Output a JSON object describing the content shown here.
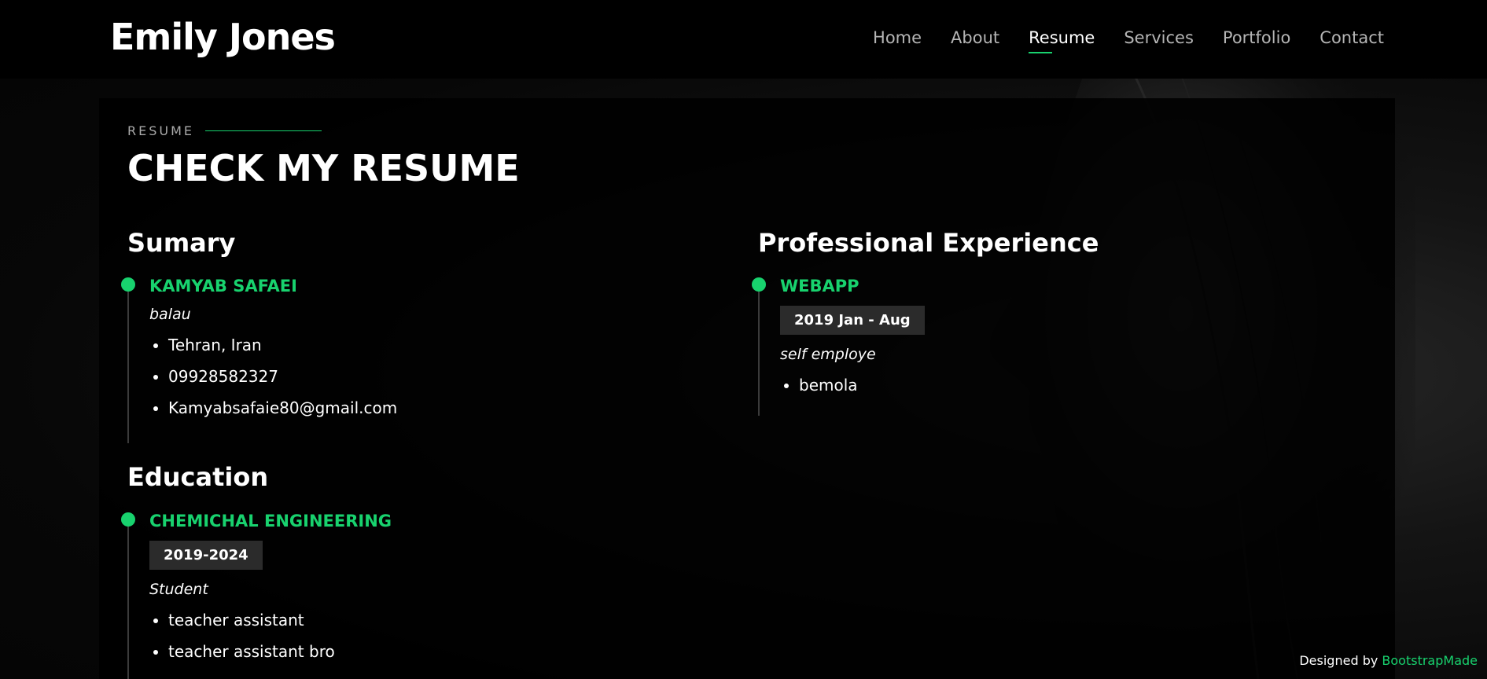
{
  "header": {
    "logo": "Emily Jones",
    "nav": [
      "Home",
      "About",
      "Resume",
      "Services",
      "Portfolio",
      "Contact"
    ],
    "active_nav": "Resume"
  },
  "resume": {
    "label": "RESUME",
    "title": "CHECK MY RESUME",
    "summary": {
      "heading": "Sumary",
      "name": "KAMYAB SAFAEI",
      "subtitle": "balau",
      "details": [
        "Tehran, Iran",
        "09928582327",
        "Kamyabsafaie80@gmail.com"
      ]
    },
    "education": {
      "heading": "Education",
      "title": "CHEMICHAL ENGINEERING",
      "period": "2019-2024",
      "subtitle": "Student",
      "details": [
        "teacher assistant",
        "teacher assistant bro"
      ]
    },
    "experience": {
      "heading": "Professional Experience",
      "title": "WEBAPP",
      "period": "2019 Jan - Aug",
      "subtitle": "self employe",
      "details": [
        "bemola"
      ]
    }
  },
  "credit": {
    "prefix": "Designed by",
    "link": "BootstrapMade"
  },
  "colors": {
    "accent": "#18d26e",
    "background": "#050505",
    "badge": "#2b2b2b"
  }
}
